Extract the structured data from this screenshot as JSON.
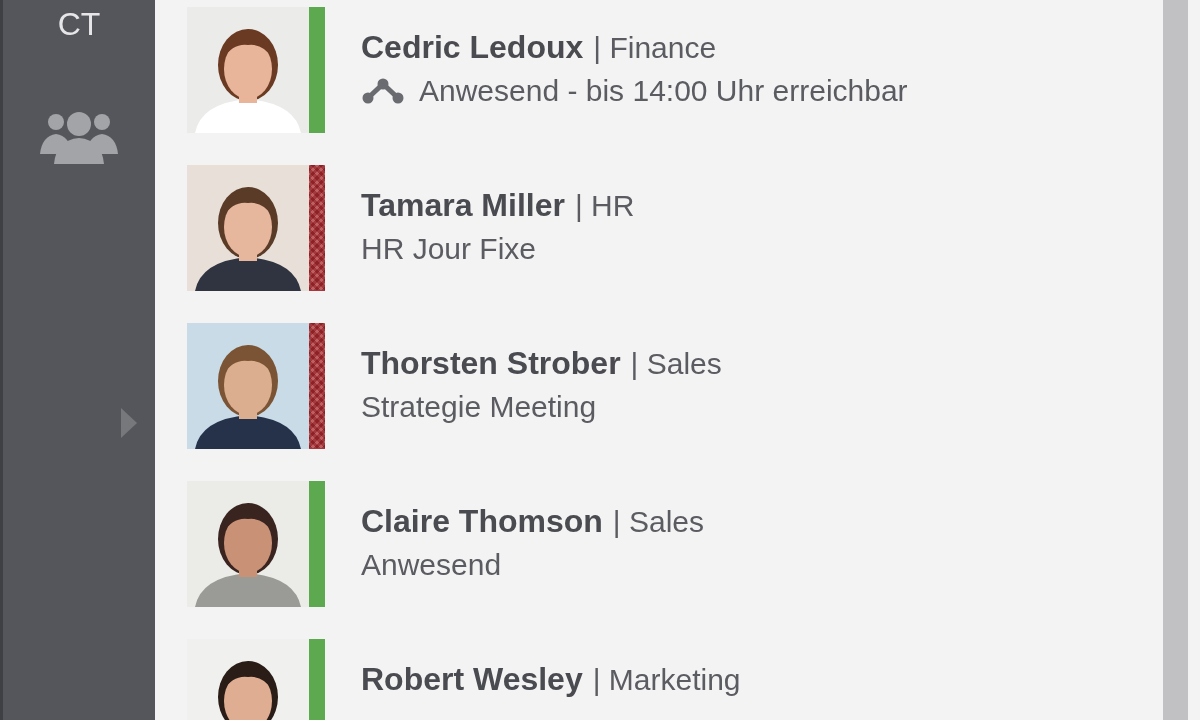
{
  "sidebar": {
    "initials": "CT"
  },
  "contacts": [
    {
      "name": "Cedric Ledoux",
      "department": "| Finance",
      "kind": "available",
      "presence_icon": true,
      "note": "Anwesend - bis 14:00 Uhr erreichbar"
    },
    {
      "name": "Tamara Miller",
      "department": "| HR",
      "kind": "meeting",
      "presence_icon": false,
      "note": "HR Jour Fixe"
    },
    {
      "name": "Thorsten Strober",
      "department": "| Sales",
      "kind": "meeting",
      "presence_icon": false,
      "note": "Strategie Meeting"
    },
    {
      "name": "Claire Thomson",
      "department": "| Sales",
      "kind": "available",
      "presence_icon": false,
      "note": "Anwesend"
    },
    {
      "name": "Robert Wesley",
      "department": "| Marketing",
      "kind": "available",
      "presence_icon": false
    }
  ]
}
